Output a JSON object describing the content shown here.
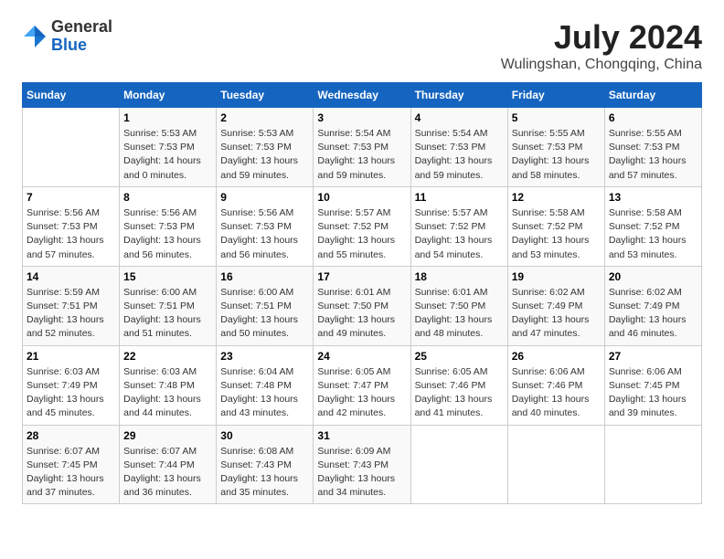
{
  "logo": {
    "general": "General",
    "blue": "Blue"
  },
  "title": "July 2024",
  "subtitle": "Wulingshan, Chongqing, China",
  "header": {
    "days": [
      "Sunday",
      "Monday",
      "Tuesday",
      "Wednesday",
      "Thursday",
      "Friday",
      "Saturday"
    ]
  },
  "weeks": [
    {
      "cells": [
        {
          "day": null,
          "info": null
        },
        {
          "day": "1",
          "info": "Sunrise: 5:53 AM\nSunset: 7:53 PM\nDaylight: 14 hours\nand 0 minutes."
        },
        {
          "day": "2",
          "info": "Sunrise: 5:53 AM\nSunset: 7:53 PM\nDaylight: 13 hours\nand 59 minutes."
        },
        {
          "day": "3",
          "info": "Sunrise: 5:54 AM\nSunset: 7:53 PM\nDaylight: 13 hours\nand 59 minutes."
        },
        {
          "day": "4",
          "info": "Sunrise: 5:54 AM\nSunset: 7:53 PM\nDaylight: 13 hours\nand 59 minutes."
        },
        {
          "day": "5",
          "info": "Sunrise: 5:55 AM\nSunset: 7:53 PM\nDaylight: 13 hours\nand 58 minutes."
        },
        {
          "day": "6",
          "info": "Sunrise: 5:55 AM\nSunset: 7:53 PM\nDaylight: 13 hours\nand 57 minutes."
        }
      ]
    },
    {
      "cells": [
        {
          "day": "7",
          "info": "Sunrise: 5:56 AM\nSunset: 7:53 PM\nDaylight: 13 hours\nand 57 minutes."
        },
        {
          "day": "8",
          "info": "Sunrise: 5:56 AM\nSunset: 7:53 PM\nDaylight: 13 hours\nand 56 minutes."
        },
        {
          "day": "9",
          "info": "Sunrise: 5:56 AM\nSunset: 7:53 PM\nDaylight: 13 hours\nand 56 minutes."
        },
        {
          "day": "10",
          "info": "Sunrise: 5:57 AM\nSunset: 7:52 PM\nDaylight: 13 hours\nand 55 minutes."
        },
        {
          "day": "11",
          "info": "Sunrise: 5:57 AM\nSunset: 7:52 PM\nDaylight: 13 hours\nand 54 minutes."
        },
        {
          "day": "12",
          "info": "Sunrise: 5:58 AM\nSunset: 7:52 PM\nDaylight: 13 hours\nand 53 minutes."
        },
        {
          "day": "13",
          "info": "Sunrise: 5:58 AM\nSunset: 7:52 PM\nDaylight: 13 hours\nand 53 minutes."
        }
      ]
    },
    {
      "cells": [
        {
          "day": "14",
          "info": "Sunrise: 5:59 AM\nSunset: 7:51 PM\nDaylight: 13 hours\nand 52 minutes."
        },
        {
          "day": "15",
          "info": "Sunrise: 6:00 AM\nSunset: 7:51 PM\nDaylight: 13 hours\nand 51 minutes."
        },
        {
          "day": "16",
          "info": "Sunrise: 6:00 AM\nSunset: 7:51 PM\nDaylight: 13 hours\nand 50 minutes."
        },
        {
          "day": "17",
          "info": "Sunrise: 6:01 AM\nSunset: 7:50 PM\nDaylight: 13 hours\nand 49 minutes."
        },
        {
          "day": "18",
          "info": "Sunrise: 6:01 AM\nSunset: 7:50 PM\nDaylight: 13 hours\nand 48 minutes."
        },
        {
          "day": "19",
          "info": "Sunrise: 6:02 AM\nSunset: 7:49 PM\nDaylight: 13 hours\nand 47 minutes."
        },
        {
          "day": "20",
          "info": "Sunrise: 6:02 AM\nSunset: 7:49 PM\nDaylight: 13 hours\nand 46 minutes."
        }
      ]
    },
    {
      "cells": [
        {
          "day": "21",
          "info": "Sunrise: 6:03 AM\nSunset: 7:49 PM\nDaylight: 13 hours\nand 45 minutes."
        },
        {
          "day": "22",
          "info": "Sunrise: 6:03 AM\nSunset: 7:48 PM\nDaylight: 13 hours\nand 44 minutes."
        },
        {
          "day": "23",
          "info": "Sunrise: 6:04 AM\nSunset: 7:48 PM\nDaylight: 13 hours\nand 43 minutes."
        },
        {
          "day": "24",
          "info": "Sunrise: 6:05 AM\nSunset: 7:47 PM\nDaylight: 13 hours\nand 42 minutes."
        },
        {
          "day": "25",
          "info": "Sunrise: 6:05 AM\nSunset: 7:46 PM\nDaylight: 13 hours\nand 41 minutes."
        },
        {
          "day": "26",
          "info": "Sunrise: 6:06 AM\nSunset: 7:46 PM\nDaylight: 13 hours\nand 40 minutes."
        },
        {
          "day": "27",
          "info": "Sunrise: 6:06 AM\nSunset: 7:45 PM\nDaylight: 13 hours\nand 39 minutes."
        }
      ]
    },
    {
      "cells": [
        {
          "day": "28",
          "info": "Sunrise: 6:07 AM\nSunset: 7:45 PM\nDaylight: 13 hours\nand 37 minutes."
        },
        {
          "day": "29",
          "info": "Sunrise: 6:07 AM\nSunset: 7:44 PM\nDaylight: 13 hours\nand 36 minutes."
        },
        {
          "day": "30",
          "info": "Sunrise: 6:08 AM\nSunset: 7:43 PM\nDaylight: 13 hours\nand 35 minutes."
        },
        {
          "day": "31",
          "info": "Sunrise: 6:09 AM\nSunset: 7:43 PM\nDaylight: 13 hours\nand 34 minutes."
        },
        {
          "day": null,
          "info": null
        },
        {
          "day": null,
          "info": null
        },
        {
          "day": null,
          "info": null
        }
      ]
    }
  ]
}
